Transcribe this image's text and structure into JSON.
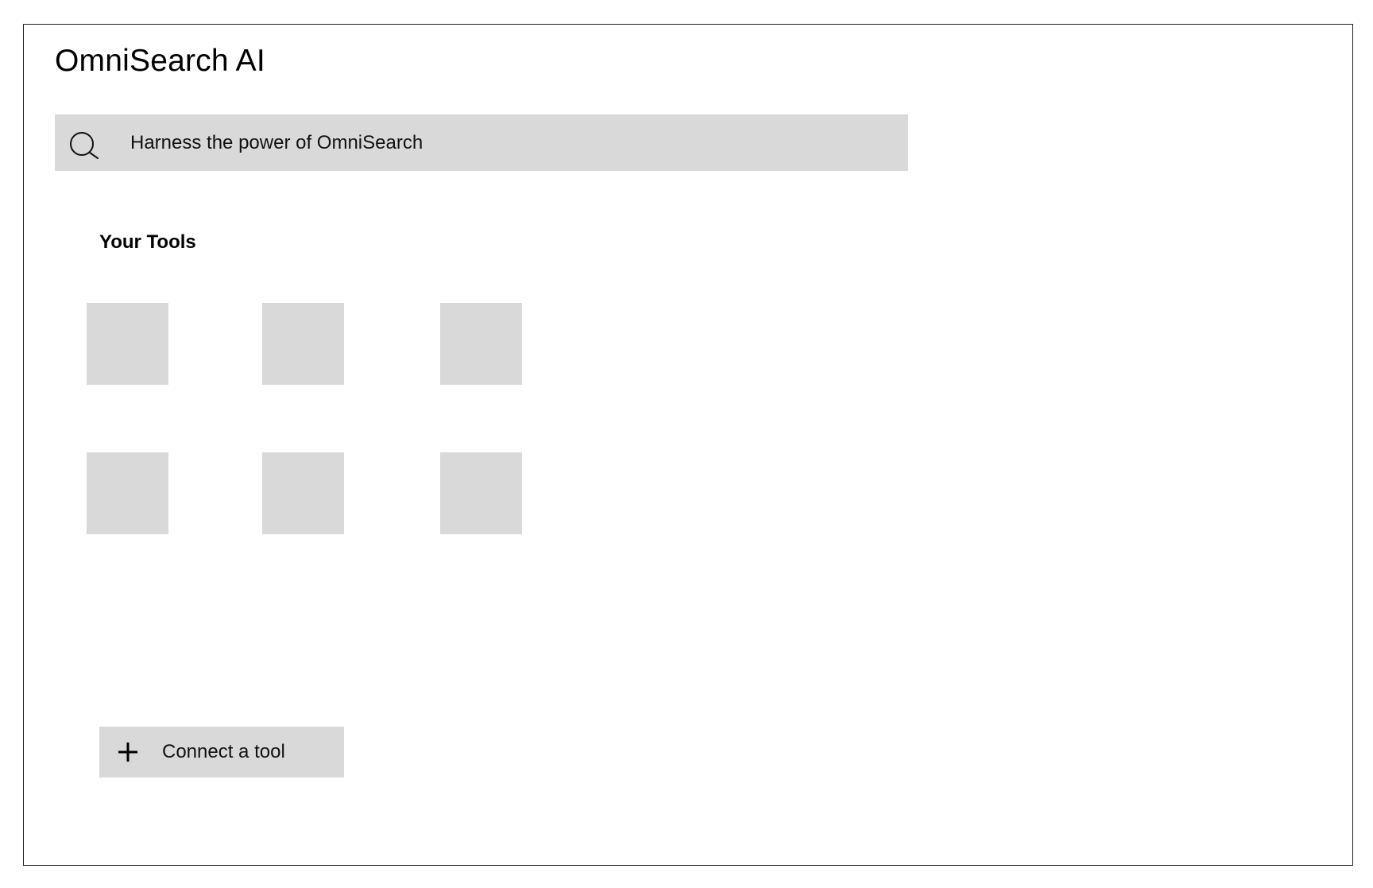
{
  "app": {
    "title": "OmniSearch AI"
  },
  "search": {
    "placeholder": "Harness the power of OmniSearch",
    "value": "",
    "icon": "search-icon"
  },
  "tools_section": {
    "title": "Your Tools",
    "tiles": [
      {
        "name": "tool-tile-1"
      },
      {
        "name": "tool-tile-2"
      },
      {
        "name": "tool-tile-3"
      },
      {
        "name": "tool-tile-4"
      },
      {
        "name": "tool-tile-5"
      },
      {
        "name": "tool-tile-6"
      }
    ]
  },
  "connect_button": {
    "label": "Connect a tool",
    "icon": "plus-icon"
  },
  "colors": {
    "placeholder_fill": "#d9d9d9",
    "border": "#222222",
    "text": "#000000"
  }
}
